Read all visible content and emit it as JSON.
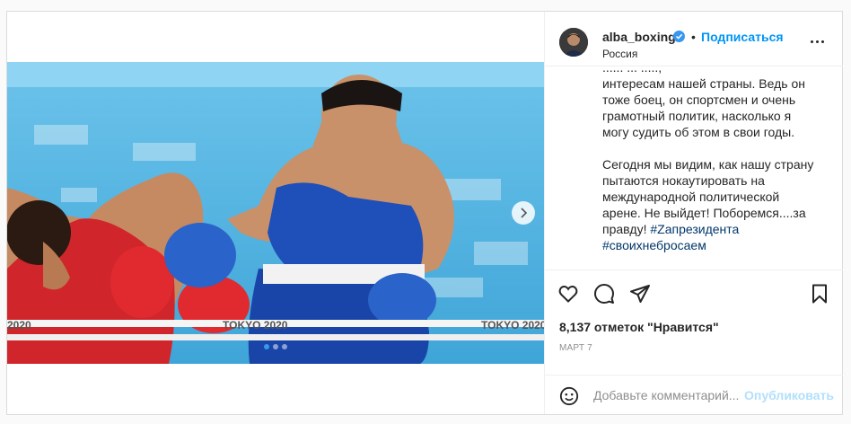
{
  "header": {
    "username": "alba_boxing",
    "separator": "•",
    "follow_label": "Подписаться",
    "location": "Россия"
  },
  "caption": {
    "cut_line": "...... ... .....,",
    "paragraph1": "интересам нашей страны. Ведь он тоже боец, он спортсмен и очень грамотный политик, насколько я могу судить об этом в свои годы.",
    "paragraph2": "Сегодня мы видим, как нашу страну пытаются нокаутировать на международной политической арене. Не выйдет! Поборемся....за правду!",
    "hashtag1": "#Zапрезидента",
    "hashtag2": "#своихнебросаем"
  },
  "photo": {
    "ring_text": [
      "2020",
      "TOKYO 2020",
      "TOKYO 2020",
      "TOKYO 2020"
    ],
    "colors": {
      "red_corner": "#d0262b",
      "blue_corner": "#1f4fb8",
      "floor": "#4fb2e2"
    }
  },
  "carousel": {
    "total_slides": 3,
    "active_slide": 1
  },
  "actions": {
    "likes_text": "8,137 отметок \"Нравится\"",
    "date_text": "МАРТ 7"
  },
  "comment": {
    "placeholder": "Добавьте комментарий...",
    "publish_label": "Опубликовать"
  },
  "icons": {
    "like": "heart-icon",
    "comment": "comment-icon",
    "share": "share-icon",
    "save": "bookmark-icon",
    "emoji": "emoji-icon",
    "verified": "verified-badge-icon",
    "more": "more-options-icon",
    "next": "chevron-right-icon"
  }
}
